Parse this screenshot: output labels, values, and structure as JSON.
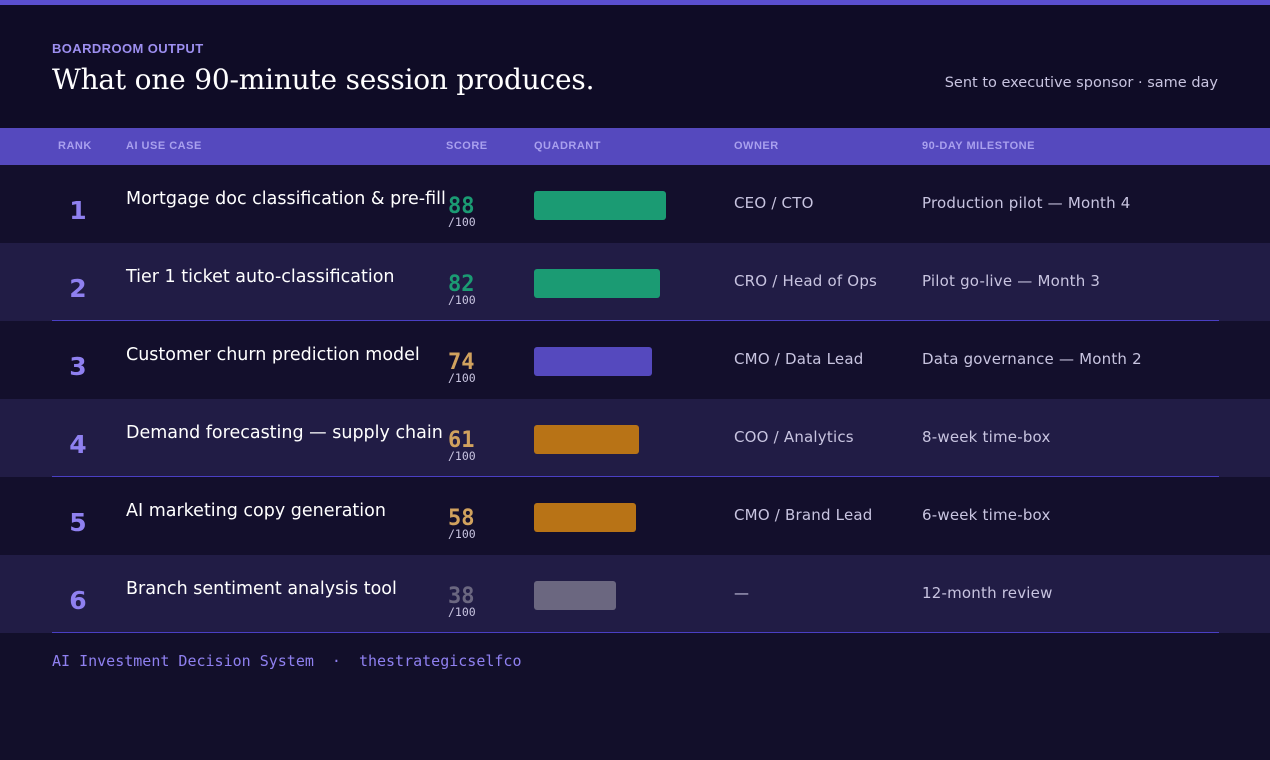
{
  "header": {
    "eyebrow": "BOARDROOM OUTPUT",
    "title": "What one 90-minute session produces.",
    "subtitle": "Sent to executive sponsor · same day"
  },
  "table": {
    "columns": [
      "RANK",
      "AI USE CASE",
      "SCORE",
      "QUADRANT",
      "OWNER",
      "90-DAY MILESTONE"
    ],
    "rows": [
      {
        "rank": "1",
        "use_case": "Mortgage doc classification & pre-fill",
        "score": "88",
        "out_of": "/100",
        "score_value": 88,
        "quadrant_color": "#1b9b73",
        "owner": "CEO / CTO",
        "milestone": "Production pilot — Month 4"
      },
      {
        "rank": "2",
        "use_case": "Tier 1 ticket auto-classification",
        "score": "82",
        "out_of": "/100",
        "score_value": 82,
        "quadrant_color": "#1b9b73",
        "owner": "CRO / Head of Ops",
        "milestone": "Pilot go-live — Month 3"
      },
      {
        "rank": "3",
        "use_case": "Customer churn prediction model",
        "score": "74",
        "out_of": "/100",
        "score_value": 74,
        "quadrant_color": "#5549be",
        "owner": "CMO / Data Lead",
        "milestone": "Data governance — Month 2"
      },
      {
        "rank": "4",
        "use_case": "Demand forecasting — supply chain",
        "score": "61",
        "out_of": "/100",
        "score_value": 61,
        "quadrant_color": "#b87316",
        "owner": "COO / Analytics",
        "milestone": "8-week time-box"
      },
      {
        "rank": "5",
        "use_case": "AI marketing copy generation",
        "score": "58",
        "out_of": "/100",
        "score_value": 58,
        "quadrant_color": "#b87316",
        "owner": "CMO / Brand Lead",
        "milestone": "6-week time-box"
      },
      {
        "rank": "6",
        "use_case": "Branch sentiment analysis tool",
        "score": "38",
        "out_of": "/100",
        "score_value": 38,
        "quadrant_color": "#6b6780",
        "owner": "—",
        "milestone": "12-month review"
      }
    ]
  },
  "colors": {
    "score_green": "#1b9b73",
    "score_amber": "#d1a25e",
    "score_muted": "#6b6780"
  },
  "footer": {
    "left": "AI Investment Decision System",
    "separator": "·",
    "right": "thestrategicselfco"
  }
}
